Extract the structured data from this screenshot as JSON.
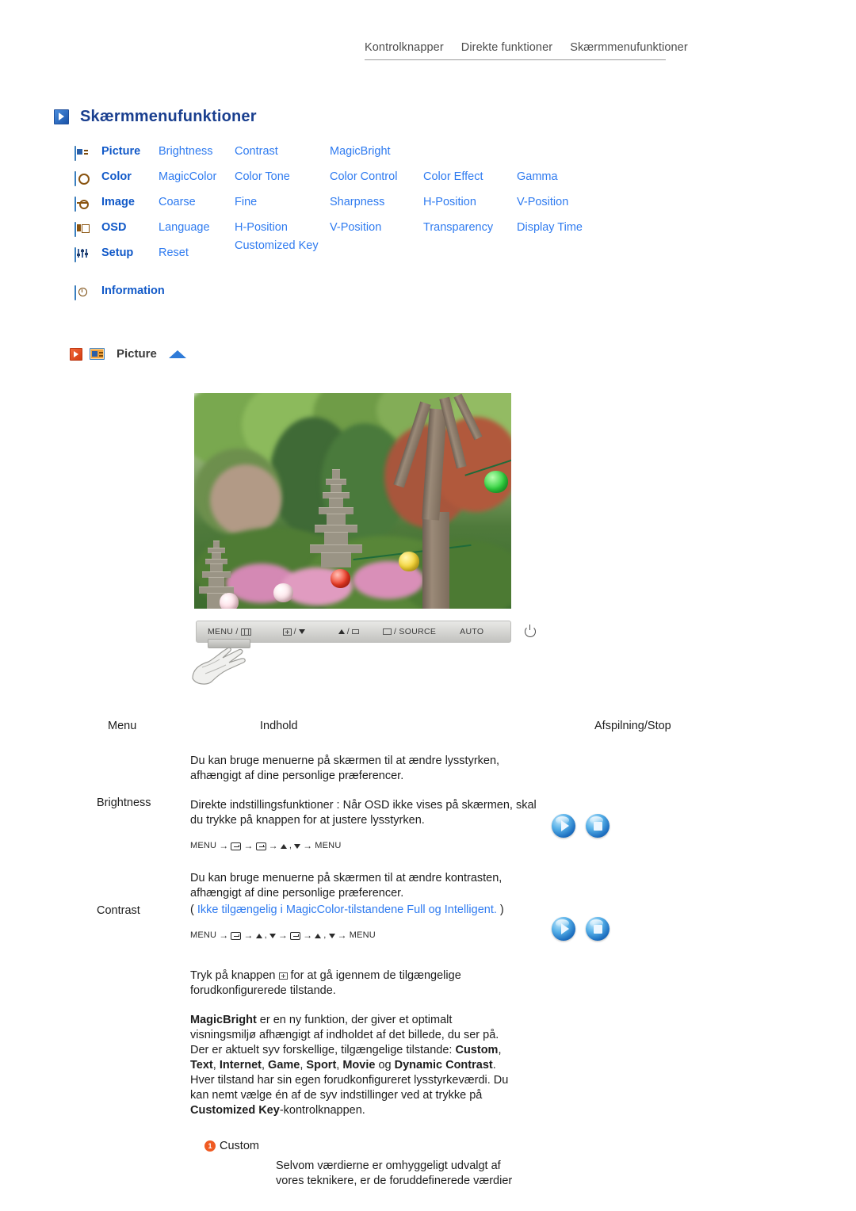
{
  "topnav": {
    "items": [
      {
        "label": "Kontrolknapper"
      },
      {
        "label": "Direkte funktioner"
      },
      {
        "label": "Skærmmenufunktioner"
      }
    ]
  },
  "page": {
    "title": "Skærmmenufunktioner"
  },
  "menu_matrix": {
    "rows": [
      {
        "icon": "picture-icon",
        "head": "Picture",
        "cells": [
          "Brightness",
          "Contrast",
          "MagicBright",
          "",
          ""
        ]
      },
      {
        "icon": "color-icon",
        "head": "Color",
        "cells": [
          "MagicColor",
          "Color Tone",
          "Color Control",
          "Color Effect",
          "Gamma"
        ]
      },
      {
        "icon": "image-icon",
        "head": "Image",
        "cells": [
          "Coarse",
          "Fine",
          "Sharpness",
          "H-Position",
          "V-Position"
        ]
      },
      {
        "icon": "osd-icon",
        "head": "OSD",
        "cells": [
          "Language",
          "H-Position",
          "V-Position",
          "Transparency",
          "Display Time"
        ]
      },
      {
        "icon": "setup-icon",
        "head": "Setup",
        "cells": [
          "Reset",
          "Customized Key",
          "",
          "",
          ""
        ]
      },
      {
        "icon": "information-icon",
        "head": "Information",
        "cells": [
          "",
          "",
          "",
          "",
          ""
        ]
      }
    ]
  },
  "picture_section": {
    "label": "Picture"
  },
  "control_bar": {
    "buttons": [
      {
        "label": "MENU /",
        "glyph": "bars-icon"
      },
      {
        "label": "/",
        "glyph": "plus-box-icon",
        "glyph2": "triangle-down-icon"
      },
      {
        "label": "/",
        "glyph": "triangle-up-icon",
        "glyph2": "small-box-icon"
      },
      {
        "label": "/ SOURCE",
        "glyph": "return-box-icon"
      },
      {
        "label": "AUTO",
        "glyph": ""
      },
      {
        "label": "",
        "glyph": "power-icon"
      }
    ]
  },
  "table": {
    "headers": {
      "menu": "Menu",
      "indhold": "Indhold",
      "play": "Afspilning/Stop"
    },
    "rows": [
      {
        "menu": "Brightness",
        "p1": "Du kan bruge menuerne på skærmen til at ændre lysstyrken, afhængigt af dine personlige præferencer.",
        "p2": "Direkte indstillingsfunktioner : Når OSD ikke vises på skærmen, skal du trykke på knappen for at justere lysstyrken.",
        "keyseq_start": "MENU",
        "keyseq_end": "MENU"
      },
      {
        "menu": "Contrast",
        "p1": "Du kan bruge menuerne på skærmen til at ændre kontrasten, afhængigt af dine personlige præferencer.",
        "note_open": "(",
        "note": "Ikke tilgængelig i MagicColor-tilstandene Full og Intelligent.",
        "note_close": ")",
        "keyseq_start": "MENU",
        "keyseq_end": "MENU"
      }
    ],
    "magicbright": {
      "line1_a": "Tryk på knappen",
      "line1_b": "for at gå igennem de tilgængelige",
      "line2": "forudkonfigurerede tilstande.",
      "para_b1": "MagicBright",
      "para_t1": " er en ny funktion, der giver et optimalt",
      "para_t2": "visningsmiljø afhængigt af indholdet af det billede, du ser på.",
      "para_t3": "Der er aktuelt syv forskellige, tilgængelige tilstande: ",
      "mode1": "Custom",
      "mode2": "Text",
      "mode3": "Internet",
      "mode4": "Game",
      "mode5": "Sport",
      "mode6": "Movie",
      "conj": " og ",
      "mode7": "Dynamic Contrast",
      "para_t4": "Hver tilstand har sin egen forudkonfigureret lysstyrkeværdi. Du",
      "para_t5": "kan nemt vælge én af de syv indstillinger ved at trykke på",
      "para_b2": "Customized Key",
      "para_t6": "-kontrolknappen."
    },
    "custom_block": {
      "bullet": "1",
      "label": "Custom",
      "line1": "Selvom værdierne er omhyggeligt udvalgt af",
      "line2": "vores teknikere, er de foruddefinerede værdier"
    }
  },
  "colors": {
    "link_blue": "#2f7bf0",
    "head_blue": "#1159c8",
    "title_blue": "#1a3f8f",
    "orange": "#ef5a22",
    "icon_orange": "#f2a33c"
  }
}
